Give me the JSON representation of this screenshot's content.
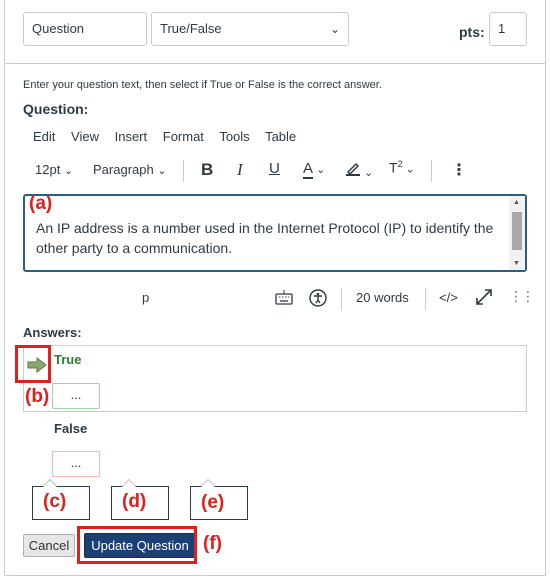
{
  "question_header": {
    "name_value": "Question",
    "type_value": "True/False",
    "pts_label": "pts:",
    "pts_value": "1"
  },
  "instructions": "Enter your question text, then select if True or False is the correct answer.",
  "question_label": "Question:",
  "editor_menu": [
    "Edit",
    "View",
    "Insert",
    "Format",
    "Tools",
    "Table"
  ],
  "toolbar": {
    "font_size": "12pt",
    "block_format": "Paragraph"
  },
  "editor": {
    "text": "An IP address is a number used in the Internet Protocol (IP) to identify the other party to a communication."
  },
  "statusbar": {
    "path": "p",
    "word_count": "20 words",
    "html_toggle": "</>"
  },
  "answers": {
    "label": "Answers:",
    "true_label": "True",
    "false_label": "False",
    "comment_placeholder": "..."
  },
  "callouts": [
    "(a)",
    "(b)",
    "(c)",
    "(d)",
    "(e)",
    "(f)"
  ],
  "buttons": {
    "cancel": "Cancel",
    "update": "Update Question"
  },
  "colors": {
    "highlight": "#e0201d",
    "primary_button": "#1c3f74",
    "correct_answer": "#2f7d32",
    "editor_focus": "#2b5d7e"
  }
}
